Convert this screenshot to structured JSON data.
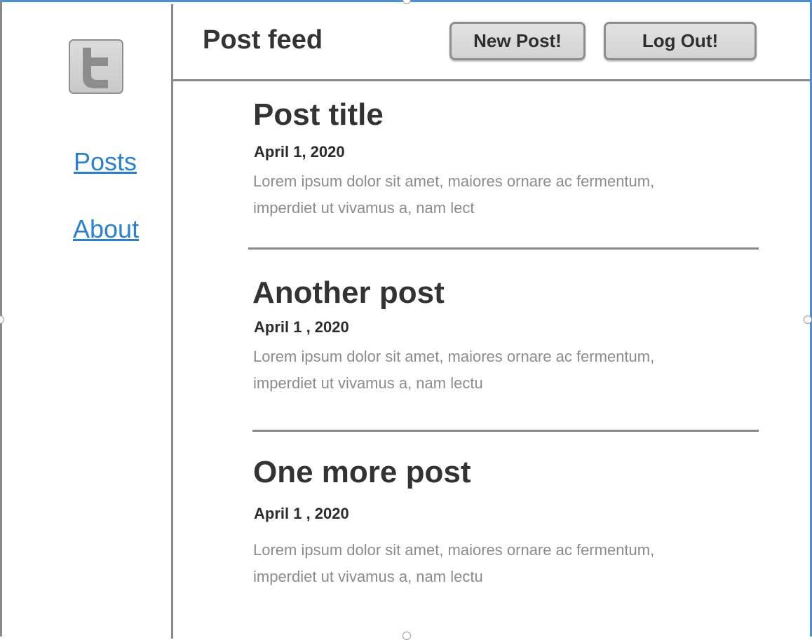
{
  "sidebar": {
    "logo_icon": "twitter-t-logo-icon",
    "items": [
      {
        "label": "Posts"
      },
      {
        "label": "About"
      }
    ]
  },
  "header": {
    "title": "Post feed",
    "new_post_label": "New Post!",
    "logout_label": "Log Out!"
  },
  "posts": [
    {
      "title": "Post title",
      "date": "April 1, 2020",
      "body": "Lorem ipsum dolor sit amet, maiores ornare ac fermentum, imperdiet ut vivamus a, nam lect"
    },
    {
      "title": "Another post",
      "date": "April 1 , 2020",
      "body": "Lorem ipsum dolor sit amet, maiores ornare ac fermentum, imperdiet ut vivamus a, nam lectu"
    },
    {
      "title": "One more post",
      "date": "April 1 , 2020",
      "body": "Lorem ipsum dolor sit amet, maiores ornare ac fermentum, imperdiet ut vivamus a, nam lectu"
    }
  ],
  "colors": {
    "link": "#2a7fd6",
    "text": "#333333",
    "muted_text": "#8c8c8c",
    "border": "#8a8a8a",
    "selection": "#4a90d9"
  }
}
